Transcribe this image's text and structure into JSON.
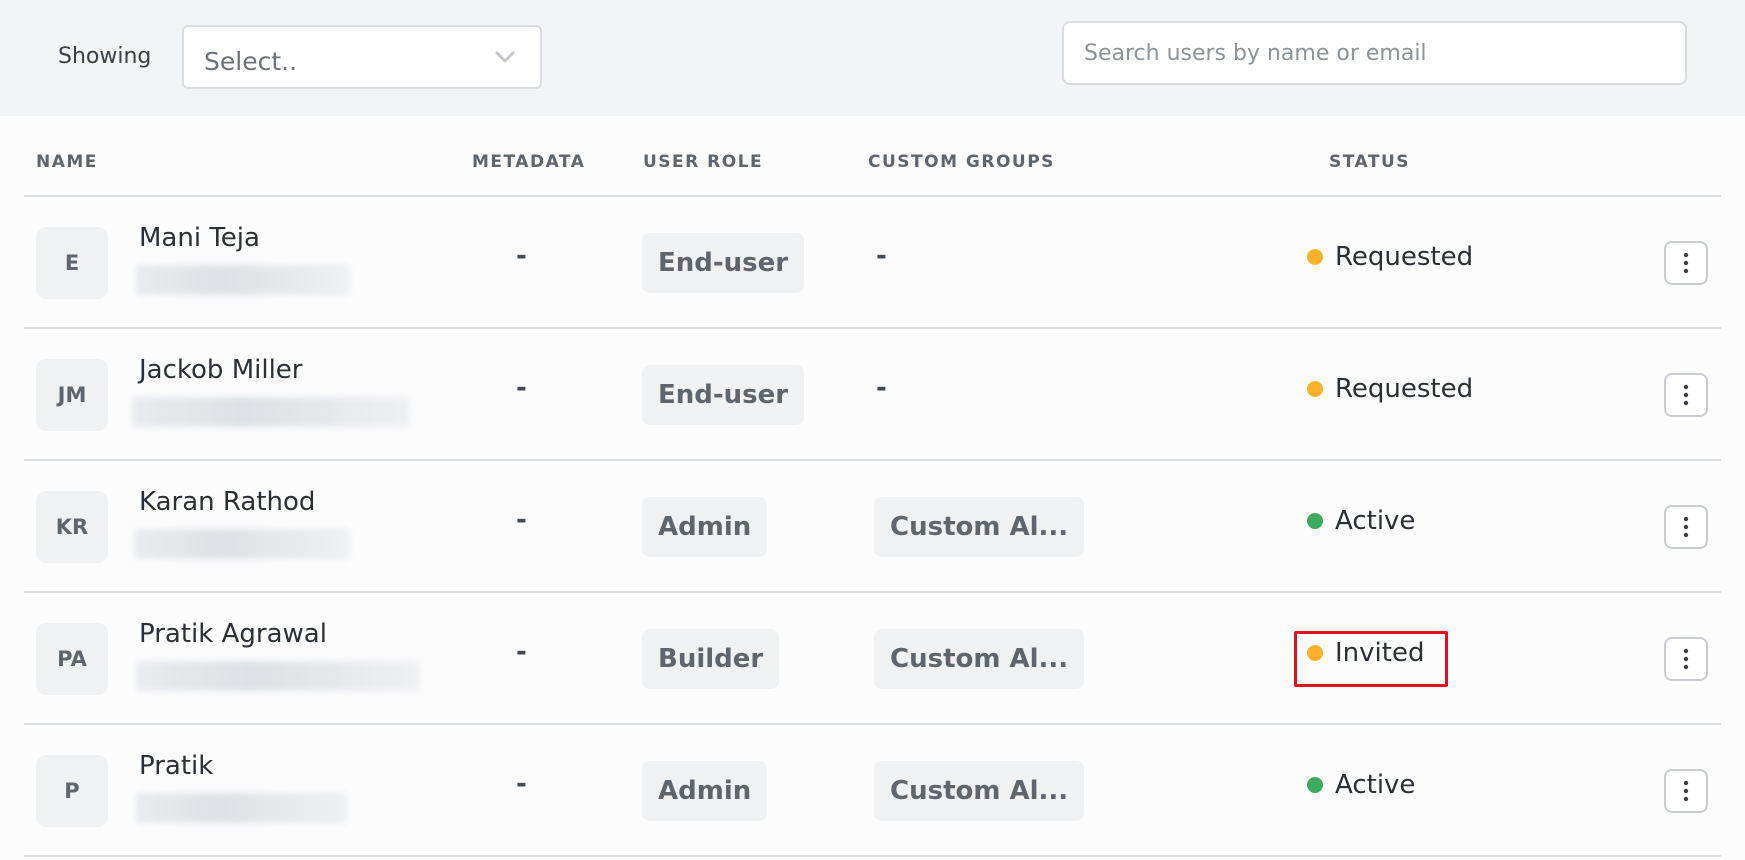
{
  "toolbar": {
    "showing_label": "Showing",
    "select_value": "Select..",
    "search_placeholder": "Search users by name or email"
  },
  "columns": {
    "name": "NAME",
    "metadata": "METADATA",
    "user_role": "USER ROLE",
    "custom_groups": "CUSTOM GROUPS",
    "status": "STATUS"
  },
  "users": [
    {
      "initials": "E",
      "name": "Mani Teja",
      "metadata": "-",
      "role": "End-user",
      "groups": "-",
      "status": "Requested",
      "status_color": "#fbb12b"
    },
    {
      "initials": "JM",
      "name": "Jackob Miller",
      "metadata": "-",
      "role": "End-user",
      "groups": "-",
      "status": "Requested",
      "status_color": "#fbb12b"
    },
    {
      "initials": "KR",
      "name": "Karan Rathod",
      "metadata": "-",
      "role": "Admin",
      "groups": "Custom Al...",
      "status": "Active",
      "status_color": "#3eaa5b"
    },
    {
      "initials": "PA",
      "name": "Pratik Agrawal",
      "metadata": "-",
      "role": "Builder",
      "groups": "Custom Al...",
      "status": "Invited",
      "status_color": "#fbb12b"
    },
    {
      "initials": "P",
      "name": "Pratik",
      "metadata": "-",
      "role": "Admin",
      "groups": "Custom Al...",
      "status": "Active",
      "status_color": "#3eaa5b"
    }
  ],
  "icons": {
    "select_chevron": "chevron-down-icon",
    "row_menu": "more-vertical-icon"
  },
  "colors": {
    "pending": "#fbb12b",
    "active": "#3eaa5b",
    "highlight": "#e0121f"
  }
}
